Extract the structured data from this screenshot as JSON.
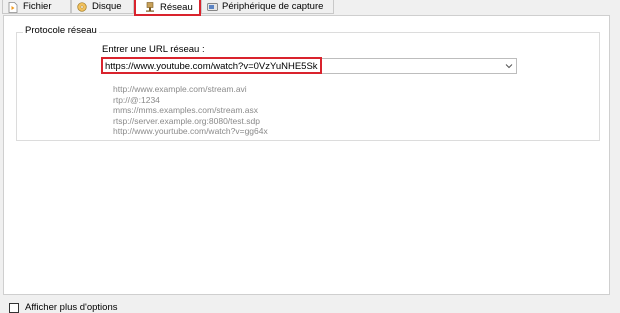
{
  "tabs": [
    {
      "label": "Fichier",
      "icon": "file-play-icon"
    },
    {
      "label": "Disque",
      "icon": "disc-icon"
    },
    {
      "label": "Réseau",
      "icon": "network-plug-icon",
      "active": true
    },
    {
      "label": "Périphérique de capture",
      "icon": "capture-device-icon"
    }
  ],
  "network": {
    "group_title": "Protocole réseau",
    "url_label": "Entrer une URL réseau :",
    "url_value": "https://www.youtube.com/watch?v=0VzYuNHE5Sk",
    "examples": [
      "http://www.example.com/stream.avi",
      "rtp://@:1234",
      "mms://mms.examples.com/stream.asx",
      "rtsp://server.example.org:8080/test.sdp",
      "http://www.yourtube.com/watch?v=gg64x"
    ]
  },
  "footer": {
    "more_options_label": "Afficher plus d'options",
    "more_options_checked": false
  },
  "colors": {
    "highlight": "#d9232d",
    "example_text": "#8a8a8a"
  }
}
